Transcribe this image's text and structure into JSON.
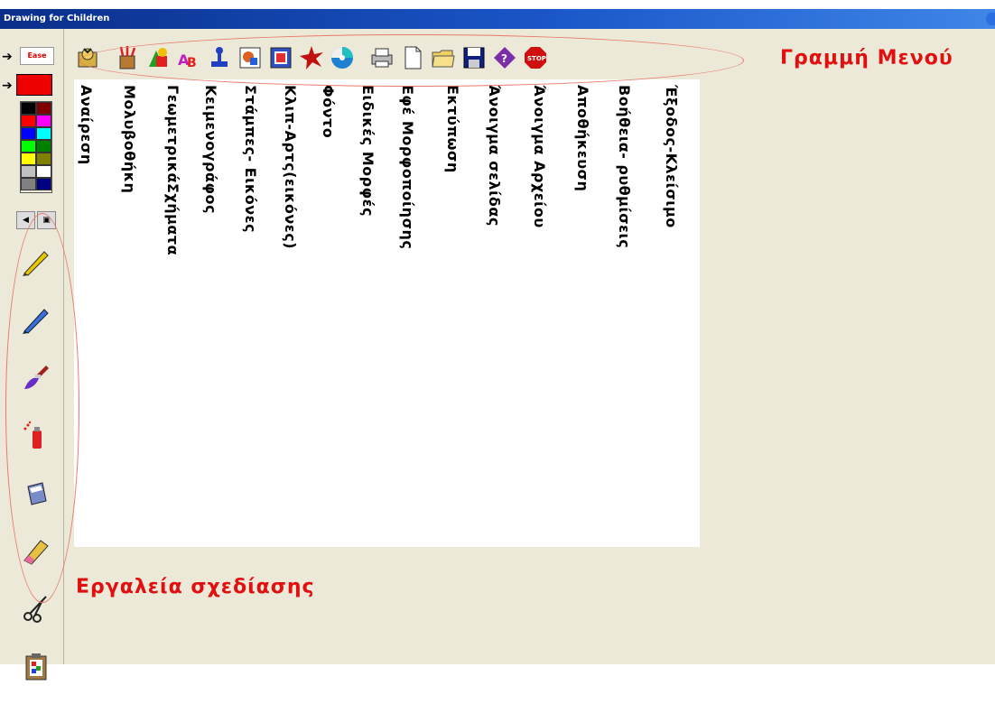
{
  "window": {
    "title": "Drawing for Children"
  },
  "toolbar": {
    "buttons": [
      {
        "name": "undo-icon"
      },
      {
        "name": "pencil-cup-icon"
      },
      {
        "name": "shapes-icon"
      },
      {
        "name": "text-icon"
      },
      {
        "name": "stamp-icon"
      },
      {
        "name": "clipart-icon"
      },
      {
        "name": "background-icon"
      },
      {
        "name": "special-shapes-icon"
      },
      {
        "name": "effects-icon"
      },
      {
        "name": "print-icon"
      },
      {
        "name": "new-page-icon"
      },
      {
        "name": "open-folder-icon"
      },
      {
        "name": "save-icon"
      },
      {
        "name": "help-icon"
      },
      {
        "name": "stop-icon"
      }
    ]
  },
  "left_panel": {
    "erase_label": "Ease",
    "palette_colors": [
      "#000000",
      "#800000",
      "#ff0000",
      "#ff00ff",
      "#0000ff",
      "#00ffff",
      "#00ff00",
      "#008000",
      "#ffff00",
      "#808000",
      "#c0c0c0",
      "#ffffff",
      "#808080",
      "#000080"
    ],
    "current_color": "#ee0000"
  },
  "canvas_labels": [
    "Αναίρεση",
    "Μολυβοθήκη",
    "ΓεωμετρικάΣχήματα",
    "Κειμενογράφος",
    "Στάμπες- Εικόνες",
    "Κλιπ-Αρτς(εικόνες)",
    "Φόντο",
    "Ειδικές Μορφές",
    "Εφέ Μορφοποίησης",
    "Εκτύπωση",
    "Άνοιγμα σελίδας",
    "Άνοιγμα Αρχείου",
    "Αποθήκευση",
    "Βοήθεια- ρυθμίσεις",
    "Έξοδος-Κλείσιμο"
  ],
  "annotations": {
    "toolbar_caption": "Γραμμή Μενού",
    "tools_caption": "Εργαλεία σχεδίασης"
  },
  "colors": {
    "annotation": "#e01010",
    "titlebar": "#1a56c8",
    "background": "#ece9d8"
  }
}
